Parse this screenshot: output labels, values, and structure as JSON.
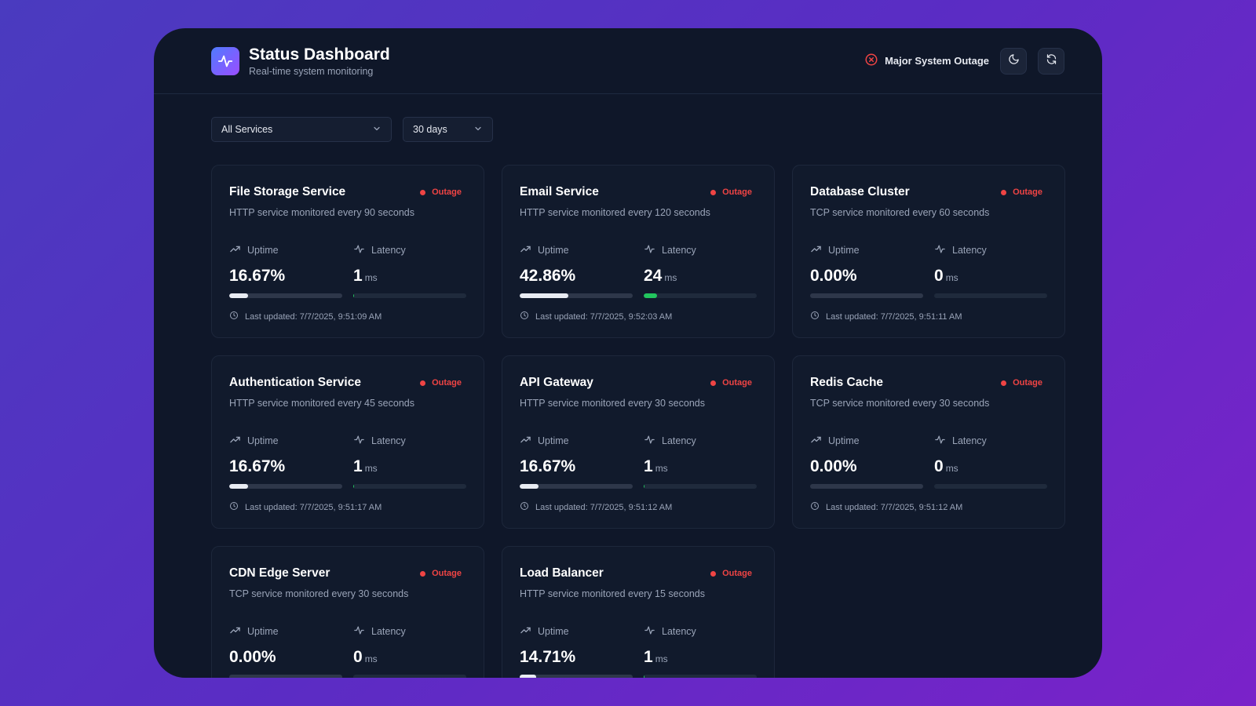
{
  "header": {
    "title": "Status Dashboard",
    "subtitle": "Real-time system monitoring",
    "status_text": "Major System Outage"
  },
  "filters": {
    "service": "All Services",
    "range": "30 days"
  },
  "labels": {
    "uptime": "Uptime",
    "latency": "Latency",
    "unit": "ms"
  },
  "colors": {
    "outage": "#ef4444",
    "latency_bar": "#22c55e",
    "background": "#0f1729"
  },
  "services": [
    {
      "name": "File Storage Service",
      "status": "Outage",
      "desc": "HTTP service monitored every 90 seconds",
      "uptime": "16.67%",
      "uptime_level": 16.67,
      "latency": "1",
      "latency_level": 1,
      "updated": "Last updated: 7/7/2025, 9:51:09 AM"
    },
    {
      "name": "Email Service",
      "status": "Outage",
      "desc": "HTTP service monitored every 120 seconds",
      "uptime": "42.86%",
      "uptime_level": 42.86,
      "latency": "24",
      "latency_level": 12,
      "updated": "Last updated: 7/7/2025, 9:52:03 AM"
    },
    {
      "name": "Database Cluster",
      "status": "Outage",
      "desc": "TCP service monitored every 60 seconds",
      "uptime": "0.00%",
      "uptime_level": 0,
      "latency": "0",
      "latency_level": 0,
      "updated": "Last updated: 7/7/2025, 9:51:11 AM"
    },
    {
      "name": "Authentication Service",
      "status": "Outage",
      "desc": "HTTP service monitored every 45 seconds",
      "uptime": "16.67%",
      "uptime_level": 16.67,
      "latency": "1",
      "latency_level": 1,
      "updated": "Last updated: 7/7/2025, 9:51:17 AM"
    },
    {
      "name": "API Gateway",
      "status": "Outage",
      "desc": "HTTP service monitored every 30 seconds",
      "uptime": "16.67%",
      "uptime_level": 16.67,
      "latency": "1",
      "latency_level": 1,
      "updated": "Last updated: 7/7/2025, 9:51:12 AM"
    },
    {
      "name": "Redis Cache",
      "status": "Outage",
      "desc": "TCP service monitored every 30 seconds",
      "uptime": "0.00%",
      "uptime_level": 0,
      "latency": "0",
      "latency_level": 0,
      "updated": "Last updated: 7/7/2025, 9:51:12 AM"
    },
    {
      "name": "CDN Edge Server",
      "status": "Outage",
      "desc": "TCP service monitored every 30 seconds",
      "uptime": "0.00%",
      "uptime_level": 0,
      "latency": "0",
      "latency_level": 0,
      "updated": ""
    },
    {
      "name": "Load Balancer",
      "status": "Outage",
      "desc": "HTTP service monitored every 15 seconds",
      "uptime": "14.71%",
      "uptime_level": 14.71,
      "latency": "1",
      "latency_level": 1,
      "updated": ""
    }
  ]
}
